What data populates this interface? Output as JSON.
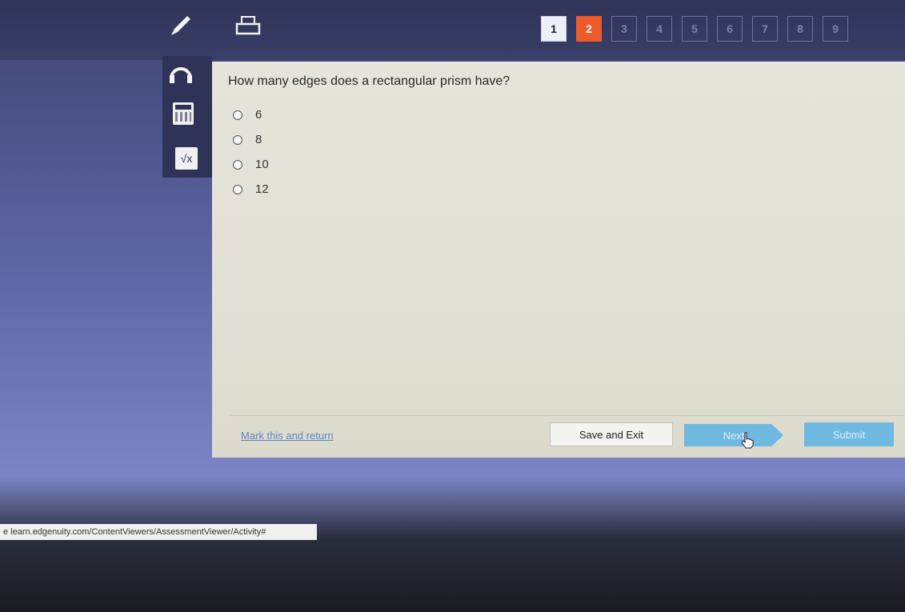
{
  "toolbar": {
    "tools": [
      "pencil-icon",
      "printer-icon",
      "headphones-icon",
      "calculator-icon",
      "sqrt-icon"
    ],
    "sqrt_symbol": "√x"
  },
  "question_nav": {
    "items": [
      {
        "label": "1",
        "state": "visited"
      },
      {
        "label": "2",
        "state": "current"
      },
      {
        "label": "3",
        "state": "unvisited"
      },
      {
        "label": "4",
        "state": "unvisited"
      },
      {
        "label": "5",
        "state": "unvisited"
      },
      {
        "label": "6",
        "state": "unvisited"
      },
      {
        "label": "7",
        "state": "unvisited"
      },
      {
        "label": "8",
        "state": "unvisited"
      },
      {
        "label": "9",
        "state": "unvisited"
      }
    ]
  },
  "question": {
    "text": "How many edges does a rectangular prism have?",
    "options": [
      "6",
      "8",
      "10",
      "12"
    ]
  },
  "footer": {
    "mark_label": "Mark this and return",
    "save_label": "Save and Exit",
    "next_label": "Next",
    "submit_label": "Submit"
  },
  "status_url": "e learn.edgenuity.com/ContentViewers/AssessmentViewer/Activity#",
  "colors": {
    "accent": "#ef5a2a",
    "button": "#6fb8df",
    "link": "#5b88c4"
  }
}
